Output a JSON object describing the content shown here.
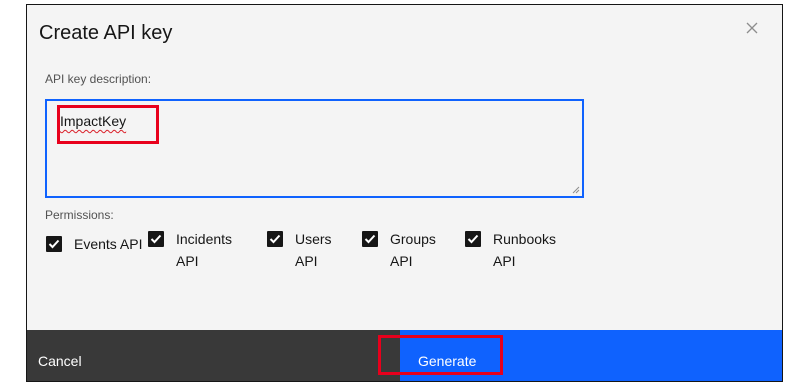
{
  "dialog": {
    "title": "Create API key",
    "close_icon": "close-icon"
  },
  "description_field": {
    "label": "API key description:",
    "value": "ImpactKey"
  },
  "permissions": {
    "label": "Permissions:",
    "items": [
      {
        "label": "Events API",
        "checked": true
      },
      {
        "label": "Incidents API",
        "checked": true
      },
      {
        "label": "Users API",
        "checked": true
      },
      {
        "label": "Groups API",
        "checked": true
      },
      {
        "label": "Runbooks API",
        "checked": true
      }
    ]
  },
  "footer": {
    "cancel_label": "Cancel",
    "generate_label": "Generate"
  },
  "colors": {
    "primary": "#0f62fe",
    "secondary": "#393939",
    "highlight": "#e8001c"
  }
}
